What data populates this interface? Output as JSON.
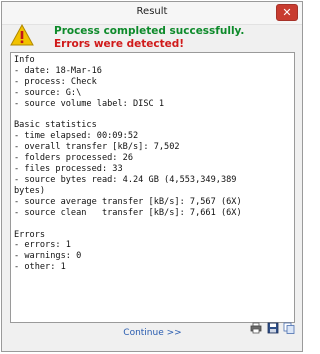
{
  "window": {
    "title": "Result",
    "close_glyph": "✕"
  },
  "header": {
    "icon": "warning-icon",
    "status_success": "Process completed successfully.",
    "status_errors": "Errors were detected!",
    "colors": {
      "success": "#0d8a2a",
      "error": "#d01a1a"
    }
  },
  "report": {
    "lines": [
      "Info",
      "- date: 18-Mar-16",
      "- process: Check",
      "- source: G:\\",
      "- source volume label: DISC 1",
      "",
      "Basic statistics",
      "- time elapsed: 00:09:52",
      "- overall transfer [kB/s]: 7,502",
      "- folders processed: 26",
      "- files processed: 33",
      "- source bytes read: 4.24 GB (4,553,349,389",
      "bytes)",
      "- source average transfer [kB/s]: 7,567 (6X)",
      "- source clean   transfer [kB/s]: 7,661 (6X)",
      "",
      "Errors",
      "- errors: 1",
      "- warnings: 0",
      "- other: 1"
    ]
  },
  "footer": {
    "continue_label": "Continue >>",
    "tools": [
      "print-icon",
      "save-icon",
      "copy-icon"
    ]
  }
}
